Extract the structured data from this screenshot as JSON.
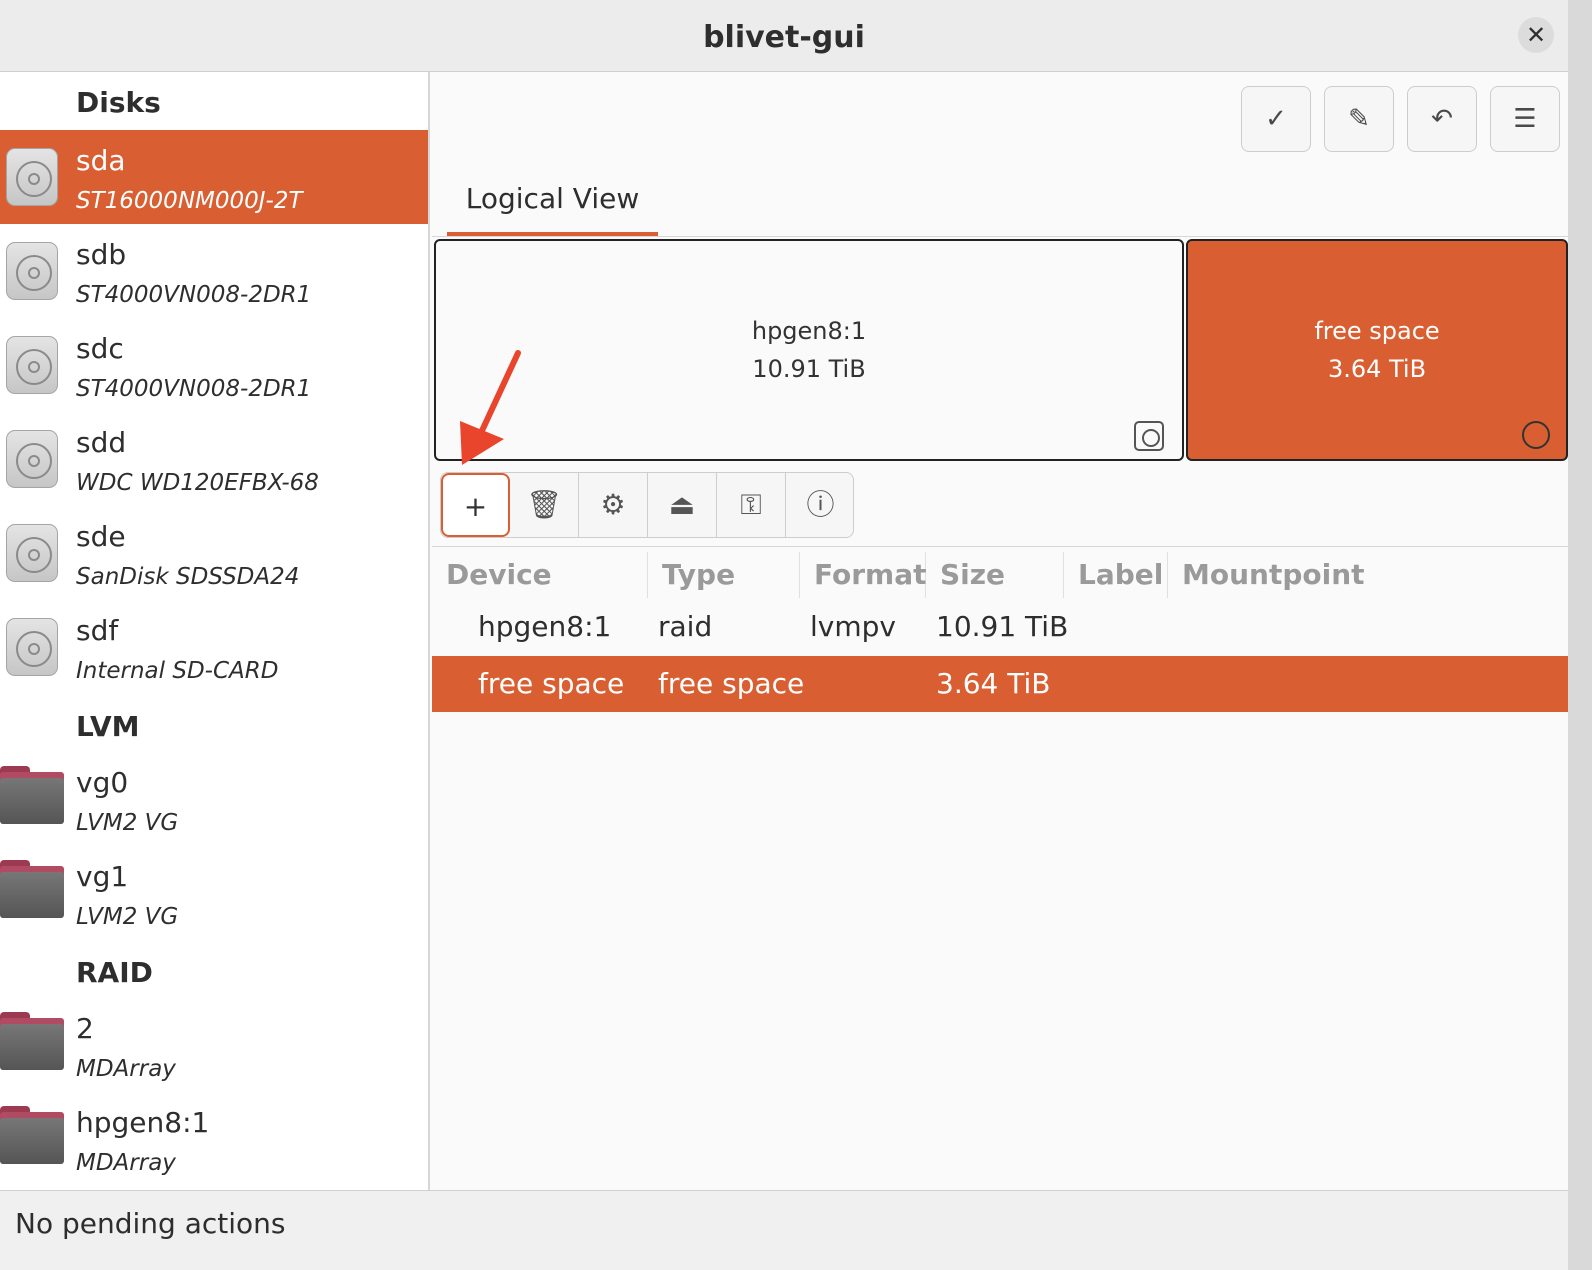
{
  "window": {
    "title": "blivet-gui"
  },
  "sidebar": {
    "sections": {
      "disks": "Disks",
      "lvm": "LVM",
      "raid": "RAID"
    },
    "disks": [
      {
        "name": "sda",
        "desc": "ST16000NM000J-2T",
        "selected": true
      },
      {
        "name": "sdb",
        "desc": "ST4000VN008-2DR1"
      },
      {
        "name": "sdc",
        "desc": "ST4000VN008-2DR1"
      },
      {
        "name": "sdd",
        "desc": "WDC WD120EFBX-68"
      },
      {
        "name": "sde",
        "desc": "SanDisk SDSSDA24"
      },
      {
        "name": "sdf",
        "desc": "Internal SD-CARD"
      }
    ],
    "lvm": [
      {
        "name": "vg0",
        "desc": "LVM2 VG"
      },
      {
        "name": "vg1",
        "desc": "LVM2 VG"
      }
    ],
    "raid": [
      {
        "name": "2",
        "desc": "MDArray"
      },
      {
        "name": "hpgen8:1",
        "desc": "MDArray"
      }
    ]
  },
  "header_buttons": {
    "apply": "✓",
    "clear": "✎",
    "undo": "↶",
    "menu": "☰"
  },
  "tabs": {
    "logical_view": "Logical View"
  },
  "blocks": [
    {
      "name": "hpgen8:1",
      "size": "10.91 TiB"
    },
    {
      "name": "free space",
      "size": "3.64 TiB"
    }
  ],
  "toolbar": {
    "add": "+",
    "delete": "🗑",
    "edit": "⚙",
    "unmount": "⏏",
    "decrypt": "⚿",
    "info": "ⓘ"
  },
  "table": {
    "columns": [
      "Device",
      "Type",
      "Format",
      "Size",
      "Label",
      "Mountpoint"
    ],
    "rows": [
      {
        "device": "hpgen8:1",
        "type": "raid",
        "format": "lvmpv",
        "size": "10.91 TiB",
        "label": "",
        "mountpoint": ""
      },
      {
        "device": "free space",
        "type": "free space",
        "format": "",
        "size": "3.64 TiB",
        "label": "",
        "mountpoint": "",
        "selected": true
      }
    ]
  },
  "status": {
    "text": "No pending actions"
  },
  "colors": {
    "accent": "#d95f33",
    "annotation_arrow": "#e8452c"
  },
  "icons": {
    "disk": "disk-icon",
    "folder": "folder-icon",
    "raid": "raid-icon",
    "free": "free-space-icon"
  }
}
